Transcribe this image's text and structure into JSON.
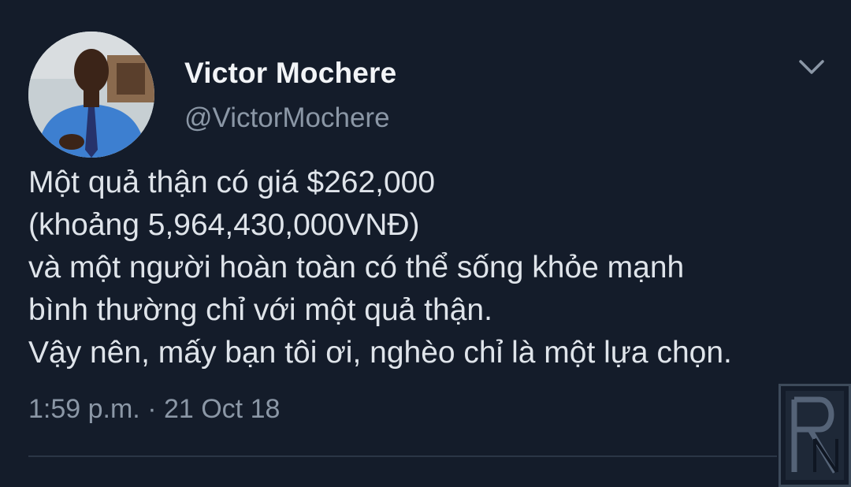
{
  "tweet": {
    "author_name": "Victor Mochere",
    "author_handle": "@VictorMochere",
    "menu_icon": "chevron-down-icon",
    "body_lines": [
      "Một quả thận có giá $262,000",
      "(khoảng 5,964,430,000VNĐ)",
      "và một người hoàn toàn có thể sống khỏe mạnh",
      "bình thường chỉ với một quả thận.",
      "Vậy nên, mấy bạn tôi ơi, nghèo chỉ là một lựa chọn."
    ],
    "timestamp": "1:59 p.m. · 21 Oct 18"
  },
  "watermark": {
    "icon": "rn-logo-icon"
  },
  "colors": {
    "background": "#141c2a",
    "name": "#f2f4f7",
    "secondary_text": "#8b97a6",
    "body_text": "#dfe4ea"
  }
}
